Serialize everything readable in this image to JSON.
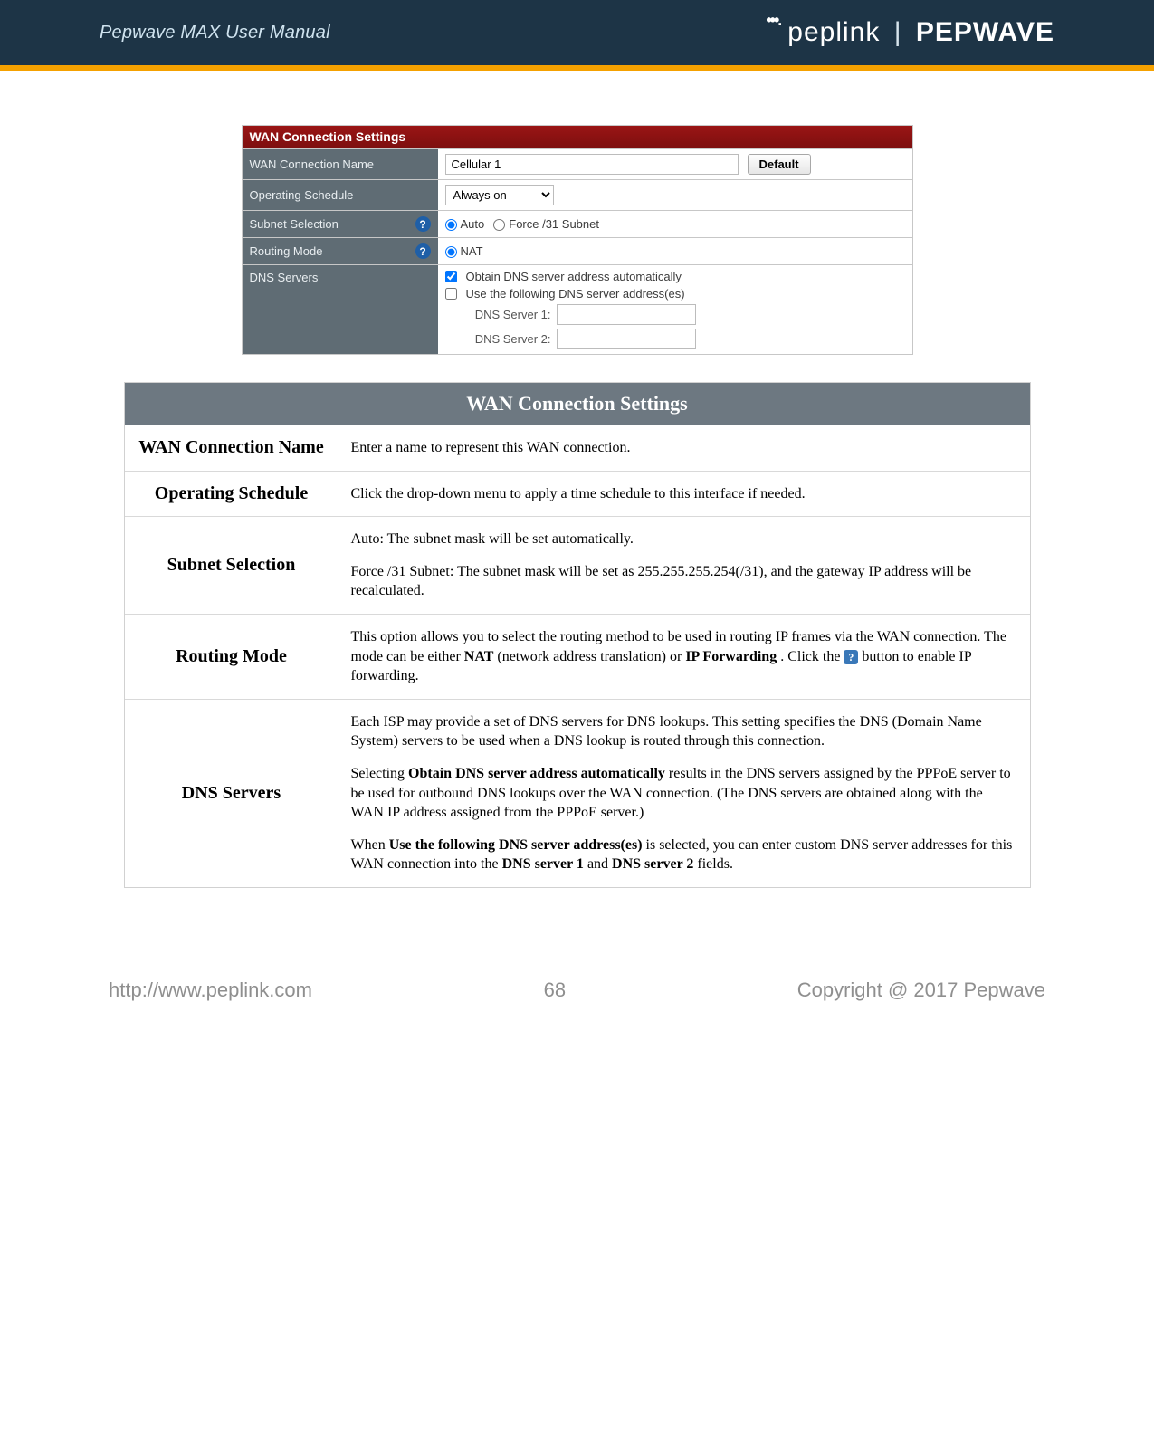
{
  "header": {
    "manual_title": "Pepwave MAX User Manual",
    "brand_left": "peplink",
    "brand_right": "PEPWAVE"
  },
  "widget": {
    "title": "WAN Connection Settings",
    "rows": {
      "name": {
        "label": "WAN Connection Name",
        "value": "Cellular 1",
        "default_btn": "Default"
      },
      "schedule": {
        "label": "Operating Schedule",
        "selected": "Always on"
      },
      "subnet": {
        "label": "Subnet Selection",
        "opt_auto": "Auto",
        "opt_force": "Force /31 Subnet",
        "help": "?"
      },
      "routing": {
        "label": "Routing Mode",
        "opt_nat": "NAT",
        "help": "?"
      },
      "dns": {
        "label": "DNS Servers",
        "cb1": "Obtain DNS server address automatically",
        "cb2": "Use the following DNS server address(es)",
        "s1": "DNS Server 1:",
        "s2": "DNS Server 2:"
      }
    }
  },
  "desc": {
    "title": "WAN Connection Settings",
    "rows": {
      "name": {
        "label": "WAN Connection Name",
        "body": "Enter a name to represent this WAN connection."
      },
      "schedule": {
        "label": "Operating Schedule",
        "body": "Click the drop-down menu to apply a time schedule to this interface if needed."
      },
      "subnet": {
        "label": "Subnet Selection",
        "p1": "Auto: The subnet mask will be set automatically.",
        "p2": "Force /31 Subnet: The subnet mask will be set as 255.255.255.254(/31), and the gateway IP address will be recalculated."
      },
      "routing": {
        "label": "Routing Mode",
        "pre": "This option allows you to select the routing method to be used in routing IP frames via the WAN connection. The mode can be either ",
        "b1": "NAT",
        "mid1": " (network address translation) or ",
        "b2": "IP Forwarding",
        "mid2": ". Click the ",
        "post": " button to enable IP forwarding."
      },
      "dns": {
        "label": "DNS Servers",
        "p1": "Each ISP may provide a set of DNS servers for DNS lookups. This setting specifies the DNS (Domain Name System) servers to be used when a DNS lookup is routed through this connection.",
        "p2_pre": "Selecting ",
        "p2_b": "Obtain DNS server address automatically",
        "p2_post": " results in the DNS servers assigned by the PPPoE server to be used for outbound DNS lookups over the WAN connection. (The DNS servers are obtained along with the WAN IP address assigned from the PPPoE server.)",
        "p3_pre": "When ",
        "p3_b": "Use the following DNS server address(es)",
        "p3_mid": " is selected, you can enter custom DNS server addresses for this WAN connection into the ",
        "p3_b2": "DNS server 1",
        "p3_and": " and ",
        "p3_b3": "DNS server 2",
        "p3_post": " fields."
      }
    }
  },
  "footer": {
    "url": "http://www.peplink.com",
    "page": "68",
    "copyright": "Copyright @ 2017 Pepwave"
  }
}
